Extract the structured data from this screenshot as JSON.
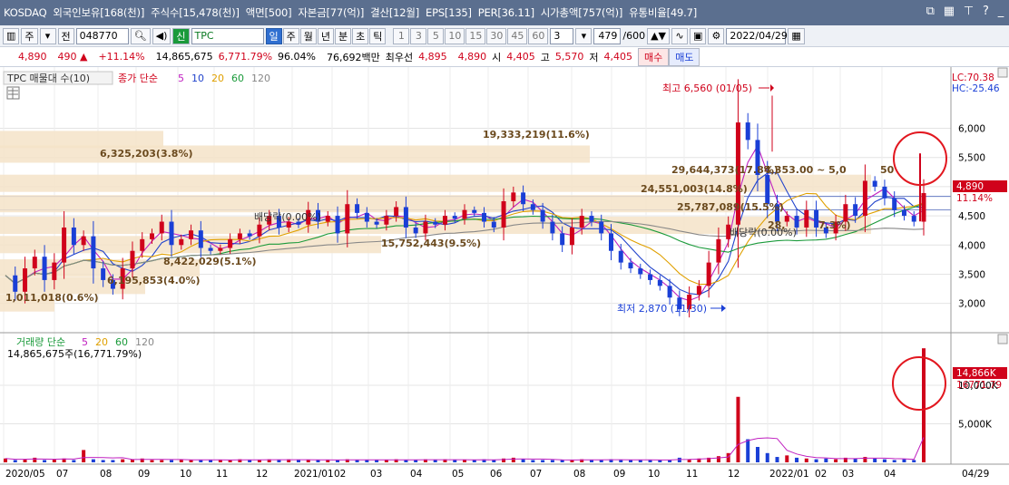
{
  "title": {
    "market": "KOSDAQ",
    "foreign": "외국인보유[168(천)]",
    "shares": "주식수[15,478(천)]",
    "par": "액면[500]",
    "capital": "자본금[77(억)]",
    "settle": "결산[12월]",
    "eps": "EPS[135]",
    "per": "PER[36.11]",
    "mcap": "시가총액[757(억)]",
    "float": "유통비율[49.7]"
  },
  "toolbar": {
    "mode": "주",
    "prev": "전",
    "code": "048770",
    "sin": "신",
    "name": "TPC",
    "periods": [
      "일",
      "주",
      "월",
      "년",
      "분",
      "초",
      "틱"
    ],
    "selected_period": "일",
    "intervals": [
      "1",
      "3",
      "5",
      "10",
      "15",
      "30",
      "45",
      "60"
    ],
    "custom_interval": "3",
    "count": "479",
    "total": "/600",
    "date": "2022/04/29"
  },
  "quote": {
    "price": "4,890",
    "change": "490 ▲",
    "pct": "+11.14%",
    "volume": "14,865,675",
    "vol_ratio": "6,771.79%",
    "turnover_ratio": "96.04%",
    "amount": "76,692백만",
    "best_label": "최우선",
    "best_ask": "4,895",
    "best_bid": "4,890",
    "open_label": "시",
    "open": "4,405",
    "high_label": "고",
    "high": "5,570",
    "low_label": "저",
    "low": "4,405",
    "buy_btn": "매수",
    "sell_btn": "매도"
  },
  "legend": {
    "main": "TPC 매물대 수(10)",
    "ma_label": "종가 단순",
    "ma_periods": [
      "5",
      "10",
      "20",
      "60",
      "120"
    ],
    "ma_colors": [
      "#c020c0",
      "#2244cc",
      "#e0a000",
      "#1a9a3a",
      "#888888"
    ],
    "lc": "LC:70.38",
    "hc": "HC:-25.46",
    "vol_label": "거래량 단순",
    "vol_periods": [
      "5",
      "20",
      "60",
      "120"
    ],
    "vol_value": "14,865,675주(16,771.79%)"
  },
  "annotations": {
    "high": "최고 6,560 (01/05)",
    "low": "최저 2,870 (11/30)",
    "div1": "배당락(0.00%)",
    "div2": "배당락(0.00%)"
  },
  "volume_profile": [
    {
      "label": "1,011,018(0.6%)"
    },
    {
      "label": "6,195,853(4.0%)"
    },
    {
      "label": "8,422,029(5.1%)"
    },
    {
      "label": "15,752,443(9.5%)"
    },
    {
      "label": "25,787,089(15.5%)"
    },
    {
      "label": "24,551,003(14.8%)"
    },
    {
      "label": "29,644,373(17.8%)"
    },
    {
      "label": "6,325,203(3.8%)"
    },
    {
      "label": "19,333,219(11.6%)"
    },
    {
      "label": "28,"
    },
    {
      "label": "7.3%)"
    }
  ],
  "range_label": "4,353.00 ~ 5,0",
  "range_label2": "50",
  "price_axis": [
    "6,000",
    "5,500",
    "5,000",
    "4,500",
    "4,000",
    "3,500",
    "3,000"
  ],
  "price_tag": "4,890",
  "price_tag_pct": "11.14%",
  "vol_axis": [
    "10,000K",
    "5,000K"
  ],
  "vol_tag": "14,866K",
  "vol_tag_pct": "16771.79",
  "x_axis": [
    "2020/05",
    "07",
    "08",
    "09",
    "10",
    "11",
    "12",
    "2021/01",
    "02",
    "03",
    "04",
    "05",
    "06",
    "07",
    "08",
    "09",
    "10",
    "11",
    "12",
    "2022/01",
    "02",
    "03",
    "04",
    "04/29"
  ],
  "colors": {
    "up": "#d0021b",
    "down": "#1a3fd6",
    "band": "#f5e3c8",
    "titlebar": "#5b6f8f"
  },
  "chart_data": {
    "type": "candlestick",
    "title": "",
    "ylim": [
      2700,
      6800
    ],
    "series": [
      {
        "name": "5",
        "values": []
      },
      {
        "name": "10",
        "values": []
      },
      {
        "name": "20",
        "values": []
      },
      {
        "name": "60",
        "values": []
      },
      {
        "name": "120",
        "values": []
      }
    ],
    "close_path": [
      3480,
      3200,
      3600,
      3800,
      3400,
      3700,
      4300,
      4000,
      4150,
      3600,
      3400,
      3250,
      3600,
      3900,
      4100,
      4200,
      4400,
      4000,
      4100,
      4250,
      3950,
      3900,
      3950,
      4100,
      4200,
      4150,
      4350,
      4500,
      4300,
      4400,
      4350,
      4600,
      4400,
      4500,
      4200,
      4700,
      4550,
      4400,
      4350,
      4500,
      4650,
      4300,
      4200,
      4400,
      4350,
      4500,
      4450,
      4600,
      4550,
      4400,
      4300,
      4750,
      4900,
      4700,
      4600,
      4400,
      4200,
      4000,
      4300,
      4500,
      4400,
      4200,
      3900,
      3700,
      3600,
      3500,
      3400,
      3300,
      3100,
      2900,
      3150,
      3300,
      3700,
      4100,
      4350,
      6100,
      5800,
      5200,
      4700,
      4400,
      4500,
      4300,
      4600,
      4300,
      4200,
      4400,
      4700,
      4500,
      5100,
      5000,
      4800,
      4600,
      4500,
      4400,
      4890
    ],
    "volume_path": [
      0.5,
      0.3,
      0.4,
      0.6,
      0.3,
      0.4,
      0.5,
      0.3,
      1.6,
      0.4,
      0.3,
      0.3,
      0.4,
      0.4,
      0.5,
      0.3,
      0.3,
      0.3,
      0.4,
      0.3,
      0.3,
      0.3,
      0.3,
      0.3,
      0.4,
      0.3,
      0.3,
      0.4,
      0.3,
      0.4,
      0.3,
      0.3,
      0.3,
      0.3,
      0.3,
      0.4,
      0.3,
      0.3,
      0.3,
      0.3,
      0.4,
      0.3,
      0.3,
      0.4,
      0.3,
      0.4,
      0.3,
      0.3,
      0.3,
      0.4,
      0.3,
      0.5,
      0.6,
      0.4,
      0.3,
      0.3,
      0.3,
      0.3,
      0.3,
      0.4,
      0.3,
      0.3,
      0.4,
      0.3,
      0.3,
      0.3,
      0.3,
      0.3,
      0.3,
      0.6,
      0.4,
      0.5,
      0.6,
      0.8,
      1.2,
      8.5,
      3.0,
      2.0,
      1.2,
      0.7,
      0.9,
      0.6,
      0.5,
      0.4,
      0.5,
      0.4,
      0.6,
      0.5,
      0.7,
      0.5,
      0.4,
      0.3,
      0.4,
      0.3,
      14.8
    ]
  }
}
